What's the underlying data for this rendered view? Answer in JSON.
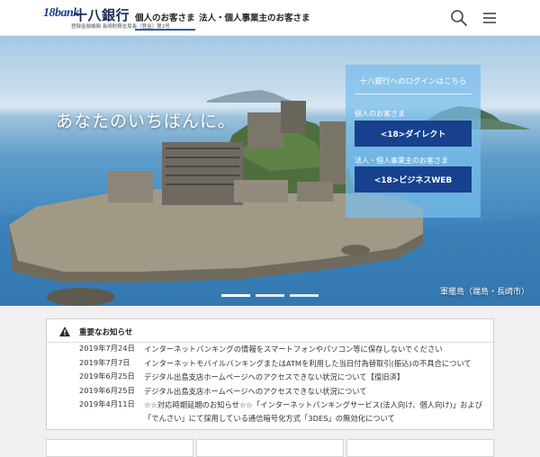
{
  "header": {
    "logo_mark": "18bank",
    "bank_name": "十八銀行",
    "registration": "登録金融機関 長崎財務支局長（登金）第2号",
    "nav": [
      {
        "label": "個人のお客さま",
        "active": true
      },
      {
        "label": "法人・個人事業主のお客さま",
        "active": false
      }
    ],
    "icons": [
      "search-icon",
      "hamburger-menu-icon"
    ]
  },
  "hero": {
    "tagline": "あなたのいちばんに。",
    "caption": "軍艦島（端島・長崎市）",
    "carousel_slides": 3,
    "active_slide": 0
  },
  "login_panel": {
    "title": "十八銀行へのログインはこちら",
    "personal_label": "個人のお客さま",
    "personal_button": "<18>ダイレクト",
    "business_label": "法人・個人事業主のお客さま",
    "business_button": "<18>ビジネスWEB"
  },
  "notices": {
    "title": "重要なお知らせ",
    "items": [
      {
        "date": "2019年7月24日",
        "text": "インターネットバンキングの情報をスマートフォンやパソコン等に保存しないでください"
      },
      {
        "date": "2019年7月7日",
        "text": "インターネットモバイルバンキングまたはATMを利用した当日付為替取引(振込)の不具合について"
      },
      {
        "date": "2019年6月25日",
        "text": "デジタル出島支店ホームページへのアクセスできない状況について【復旧済】"
      },
      {
        "date": "2019年6月25日",
        "text": "デジタル出島支店ホームページへのアクセスできない状況について"
      },
      {
        "date": "2019年4月11日",
        "text": "☆☆対応時期延期のお知らせ☆☆「インターネットバンキングサービス(法人向け、個人向け)」および「でんさい」にて採用している通信暗号化方式「3DES」の無効化について"
      }
    ]
  },
  "colors": {
    "primary": "#17408e",
    "accent": "#2f5d9a",
    "login_panel": "#78beeb"
  }
}
